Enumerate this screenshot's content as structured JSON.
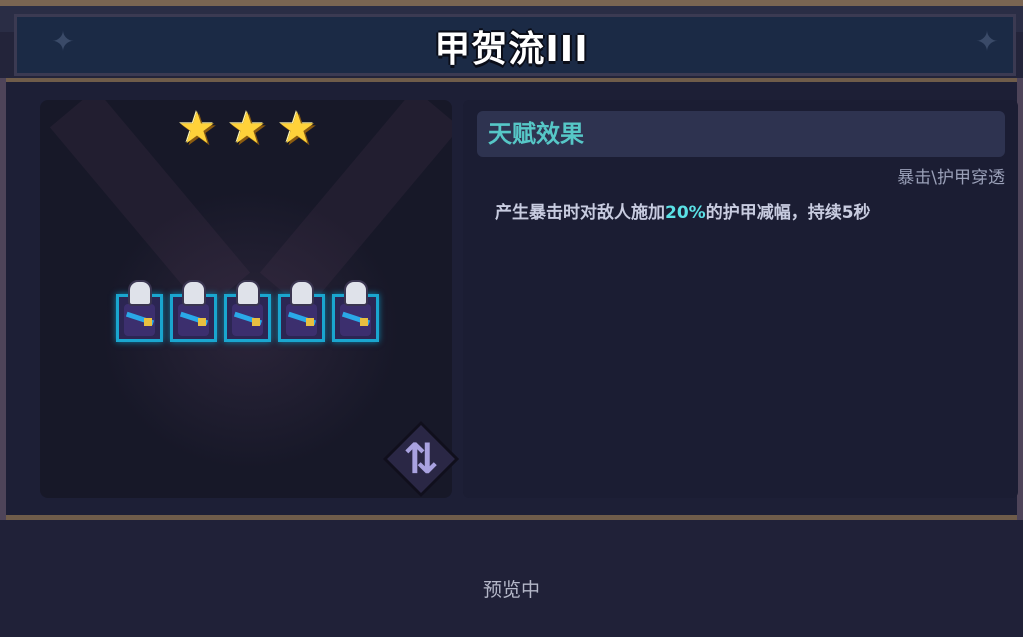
{
  "header": {
    "title": "甲贺流III"
  },
  "stars": {
    "count": 3,
    "max": 3,
    "glyph": "★",
    "color": "#ffd23a"
  },
  "team": {
    "unit_count": 5,
    "unit_icon": "ninja-unit-icon"
  },
  "swap_button": {
    "icon": "swap-arrows-icon",
    "glyph": "⇅"
  },
  "talent": {
    "title": "天赋效果",
    "tag": "暴击\\护甲穿透",
    "desc_before": "产生暴击时对敌人施加",
    "desc_highlight": "20%",
    "desc_after": "的护甲减幅，持续5秒"
  },
  "footer": {
    "status": "预览中"
  },
  "colors": {
    "accent_teal": "#56c7c7",
    "highlight": "#5be1e6",
    "border_gold": "#6f5c4a",
    "card_border": "#1aa6cf"
  }
}
